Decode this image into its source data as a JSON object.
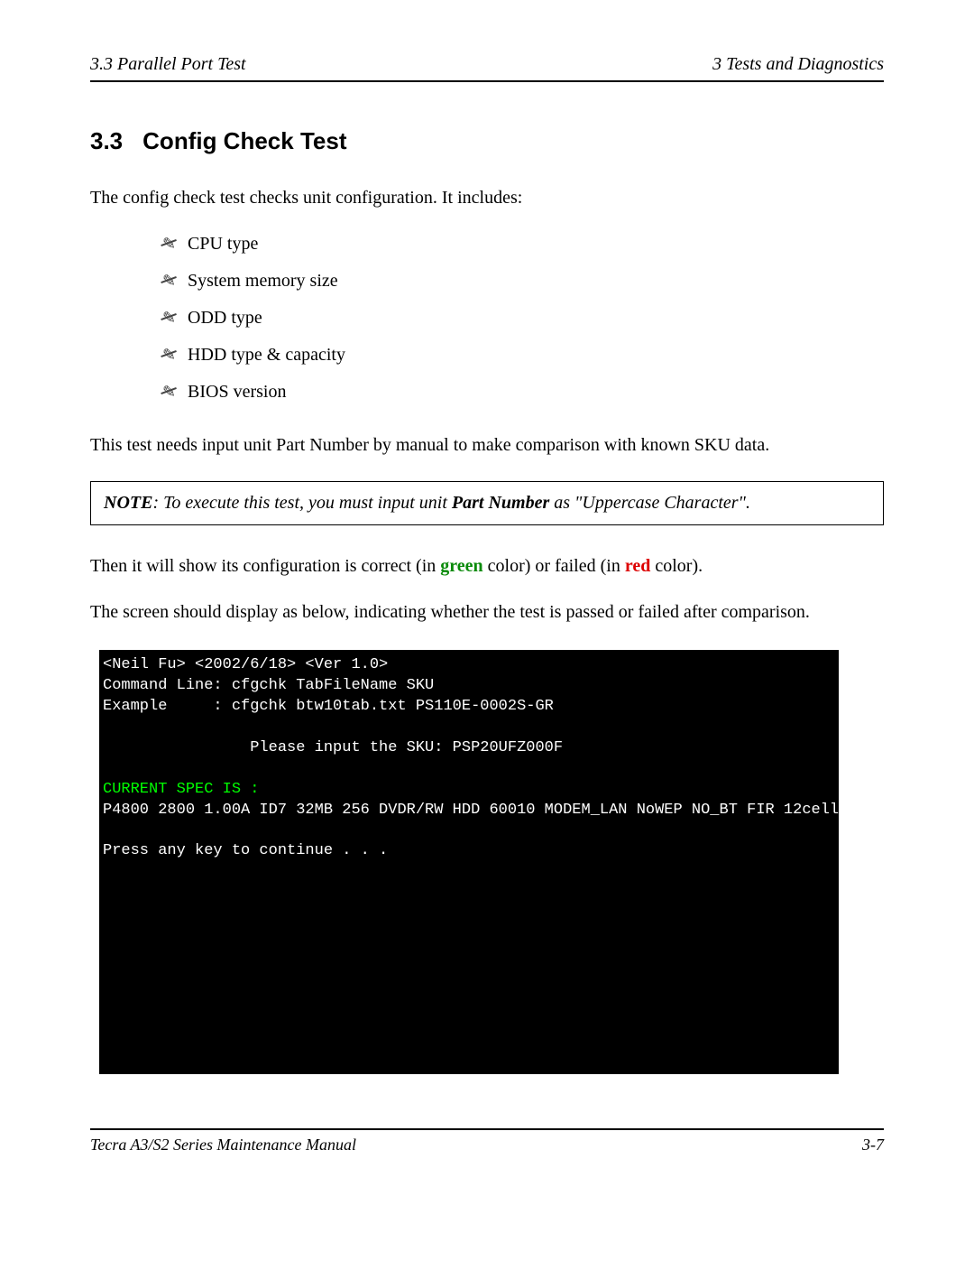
{
  "header": {
    "left": "3.3  Parallel Port Test",
    "right": "3  Tests and Diagnostics"
  },
  "section": {
    "number": "3.3",
    "title": "Config Check Test"
  },
  "intro": "The config check test checks unit configuration. It includes:",
  "checks": [
    "CPU type",
    "System memory size",
    "ODD type",
    "HDD type & capacity",
    "BIOS version"
  ],
  "para_after_list": "This test needs input unit Part Number by manual to make comparison with known SKU data.",
  "note": {
    "label": "NOTE",
    "before": ":  To execute this test, you must input unit ",
    "emph": "Part Number",
    "after": " as \"Uppercase Character\"."
  },
  "result_sentence": {
    "before": "Then it will show its configuration is correct (in ",
    "green": "green",
    "mid": " color) or failed (in ",
    "red": "red",
    "after": " color)."
  },
  "below_sentence": "The screen should display as below, indicating whether the test is passed or failed after comparison.",
  "terminal": {
    "l1": "<Neil Fu> <2002/6/18> <Ver 1.0>",
    "l2": "Command Line: cfgchk TabFileName SKU",
    "l3": "Example     : cfgchk btw10tab.txt PS110E-0002S-GR",
    "l4": "",
    "l5": "                Please input the SKU: PSP20UFZ000F",
    "l6": "",
    "l7": "CURRENT SPEC IS :",
    "l8": "P4800 2800 1.00A ID7 32MB 256 DVDR/RW HDD 60010 MODEM_LAN NoWEP NO_BT FIR 12cell",
    "l9": "",
    "l10": "Press any key to continue . . ."
  },
  "footer": {
    "left": "Tecra A3/S2 Series Maintenance Manual",
    "right": "3-7"
  }
}
